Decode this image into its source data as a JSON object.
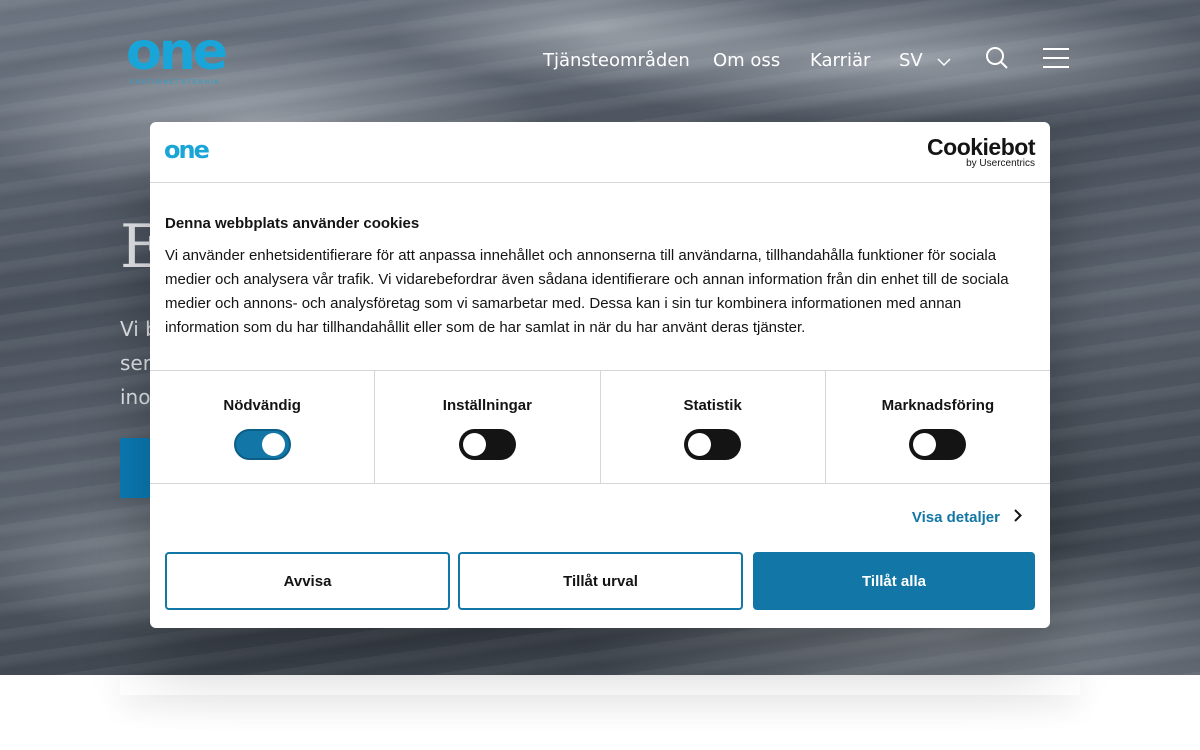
{
  "site": {
    "logo_text": "one",
    "logo_subtext": "FASTIGHETSTEKNIK",
    "nav": [
      {
        "label": "Tjänsteområden"
      },
      {
        "label": "Om oss"
      },
      {
        "label": "Karriär"
      }
    ],
    "language": "SV",
    "hero": {
      "title": "E",
      "lines": [
        "Vi b",
        "ser",
        "ino"
      ]
    }
  },
  "cookie_dialog": {
    "logo_text": "one",
    "brand_name": "Cookiebot",
    "brand_sub": "by Usercentrics",
    "title": "Denna webbplats använder cookies",
    "text": "Vi använder enhetsidentifierare för att anpassa innehållet och annonserna till användarna, tillhandahålla funktioner för sociala medier och analysera vår trafik. Vi vidarebefordrar även sådana identifierare och annan information från din enhet till de sociala medier och annons- och analysföretag som vi samarbetar med. Dessa kan i sin tur kombinera informationen med annan information som du har tillhandahållit eller som de har samlat in när du har använt deras tjänster.",
    "categories": [
      {
        "label": "Nödvändig",
        "enabled": true
      },
      {
        "label": "Inställningar",
        "enabled": false
      },
      {
        "label": "Statistik",
        "enabled": false
      },
      {
        "label": "Marknadsföring",
        "enabled": false
      }
    ],
    "details_label": "Visa detaljer",
    "buttons": {
      "reject": "Avvisa",
      "allow_selection": "Tillåt urval",
      "allow_all": "Tillåt alla"
    },
    "colors": {
      "accent": "#1276a6",
      "brand": "#1aa5d8"
    }
  }
}
